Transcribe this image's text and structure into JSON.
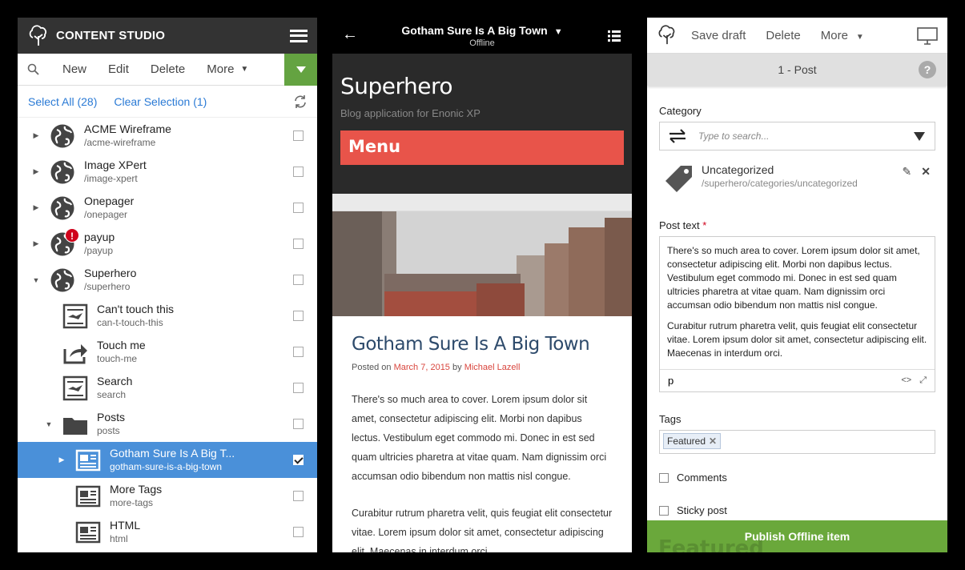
{
  "left": {
    "app_title": "CONTENT STUDIO",
    "toolbar": {
      "new": "New",
      "edit": "Edit",
      "delete": "Delete",
      "more": "More"
    },
    "select_all": "Select All (28)",
    "clear_selection": "Clear Selection (1)",
    "rows": [
      {
        "name": "ACME Wireframe",
        "path": "/acme-wireframe",
        "icon": "globe-icon"
      },
      {
        "name": "Image XPert",
        "path": "/image-xpert",
        "icon": "globe-icon"
      },
      {
        "name": "Onepager",
        "path": "/onepager",
        "icon": "globe-icon"
      },
      {
        "name": "payup",
        "path": "/payup",
        "icon": "globe-icon",
        "badge": "!"
      },
      {
        "name": "Superhero",
        "path": "/superhero",
        "icon": "globe-icon"
      },
      {
        "name": "Can't touch this",
        "path": "can-t-touch-this",
        "icon": "template-icon"
      },
      {
        "name": "Touch me",
        "path": "touch-me",
        "icon": "share-icon"
      },
      {
        "name": "Search",
        "path": "search",
        "icon": "template-icon"
      },
      {
        "name": "Posts",
        "path": "posts",
        "icon": "folder-icon"
      },
      {
        "name": "Gotham Sure Is A Big T...",
        "path": "gotham-sure-is-a-big-town",
        "icon": "article-icon",
        "selected": true
      },
      {
        "name": "More Tags",
        "path": "more-tags",
        "icon": "article-icon"
      },
      {
        "name": "HTML",
        "path": "html",
        "icon": "article-icon"
      }
    ]
  },
  "preview": {
    "title": "Gotham Sure Is A Big Town",
    "status": "Offline",
    "site_title": "Superhero",
    "site_sub": "Blog application for Enonic XP",
    "menu": "Menu",
    "article_title": "Gotham Sure Is A Big Town",
    "posted_on": "Posted on",
    "date": "March 7, 2015",
    "by": "by",
    "author": "Michael Lazell",
    "para1": "There's so much area to cover. Lorem ipsum dolor sit amet, consectetur adipiscing elit. Morbi non dapibus lectus. Vestibulum eget commodo mi. Donec in est sed quam ultricies pharetra at vitae quam. Nam dignissim orci accumsan odio bibendum non mattis nisl congue.",
    "para2": "Curabitur rutrum pharetra velit, quis feugiat elit consectetur vitae. Lorem ipsum dolor sit amet, consectetur adipiscing elit. Maecenas in interdum orci."
  },
  "editor": {
    "save_draft": "Save draft",
    "delete": "Delete",
    "more": "More",
    "subtitle": "1 - Post",
    "category_label": "Category",
    "category_placeholder": "Type to search...",
    "category_name": "Uncategorized",
    "category_path": "/superhero/categories/uncategorized",
    "post_text_label": "Post text",
    "required_mark": "*",
    "text_p1": "There's so much area to cover. Lorem ipsum dolor sit amet, consectetur adipiscing elit. Morbi non dapibus lectus. Vestibulum eget commodo mi. Donec in est sed quam ultricies pharetra at vitae quam. Nam dignissim orci accumsan odio bibendum non mattis nisl congue.",
    "text_p2": "Curabitur rutrum pharetra velit, quis feugiat elit consectetur vitae. Lorem ipsum dolor sit amet, consectetur adipiscing elit. Maecenas in interdum orci.",
    "element_path": "p",
    "tags_label": "Tags",
    "tag1": "Featured",
    "comments": "Comments",
    "sticky": "Sticky post",
    "publish": "Publish Offline item",
    "ghost": "Featured"
  }
}
